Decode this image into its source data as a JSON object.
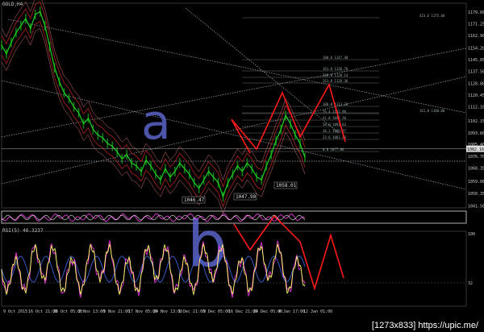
{
  "chart_data": {
    "type": "line",
    "symbol": "GOLD,H4",
    "rsi_label": "RSI(5) 46.3237",
    "price_axis": {
      "min": 1040,
      "max": 1186,
      "ticks": [
        "1179.60",
        "1171.25",
        "1162.90",
        "1154.20",
        "1145.85",
        "1137.50",
        "1128.80",
        "1120.45",
        "1112.10",
        "1102.15",
        "1093.60",
        "1085.40",
        "1076.70",
        "1068.35",
        "1059.00",
        "1050.35",
        "1041.50"
      ],
      "current_price": "1082.16"
    },
    "rsi_axis": {
      "ticks": [
        "100",
        "32"
      ]
    },
    "time_axis": [
      "9 Oct 2015",
      "16 Oct 21:00",
      "26 Oct 05:00",
      "2 Nov 13:00",
      "9 Nov 21:00",
      "17 Nov 05:00",
      "24 Nov 13:00",
      "1 Dec 21:00",
      "9 Dec 05:00",
      "16 Dec 21:00",
      "24 Dec 05:00",
      "4 Jan 17:00",
      "12 Jan 01:00"
    ],
    "price_series": {
      "name": "",
      "x": [
        0,
        6,
        12,
        18,
        24,
        30,
        36,
        42,
        48,
        54,
        60,
        66,
        72,
        78,
        84,
        90,
        96,
        102,
        108,
        114,
        120,
        126,
        132,
        138,
        144,
        150,
        156,
        162,
        168,
        174,
        180,
        186,
        192,
        198,
        204,
        210,
        216,
        222,
        228,
        234,
        240,
        246,
        252,
        258,
        264,
        270,
        276,
        282,
        288,
        294,
        300,
        306,
        312,
        318,
        324,
        330,
        336,
        342,
        348,
        354,
        360,
        366,
        372,
        378
      ],
      "values": [
        1156,
        1150,
        1158,
        1165,
        1170,
        1175,
        1168,
        1178,
        1180,
        1170,
        1155,
        1140,
        1130,
        1122,
        1118,
        1112,
        1108,
        1100,
        1104,
        1096,
        1092,
        1090,
        1086,
        1084,
        1080,
        1075,
        1078,
        1072,
        1070,
        1066,
        1074,
        1070,
        1064,
        1060,
        1068,
        1062,
        1066,
        1072,
        1068,
        1064,
        1058,
        1054,
        1060,
        1066,
        1062,
        1058,
        1048,
        1058,
        1064,
        1070,
        1066,
        1072,
        1068,
        1062,
        1060,
        1070,
        1078,
        1088,
        1096,
        1106,
        1100,
        1092,
        1086,
        1076
      ]
    },
    "price_labels": [
      "1046.47",
      "1047.90",
      "1058.01"
    ],
    "annotations": [
      "a",
      "b"
    ],
    "fib_labels": [
      "100.0 1147.40",
      "161.8 1136.70",
      "200.0 1128.14",
      "261.8 1120.36",
      "100.0 1113.20",
      "76.4 1102.90",
      "61.8 1097.20",
      "50.0 1093.63",
      "38.2 1088.37",
      "23.6 1083.40",
      "0.0 1077.00",
      "161.8 1160.00",
      "423.6 1175.60"
    ],
    "colors": {
      "price": "#1fd11f",
      "envelope": "#b22222",
      "trend": "#9aa8b4",
      "projection": "#ff1a1a",
      "rsi_main": "#ffff66",
      "rsi_signal": "#ff3cf0",
      "rsi_blue": "#3a62d8",
      "annotation": "#5b64c8"
    }
  },
  "watermark": "[1273x833] https://upic.me/"
}
